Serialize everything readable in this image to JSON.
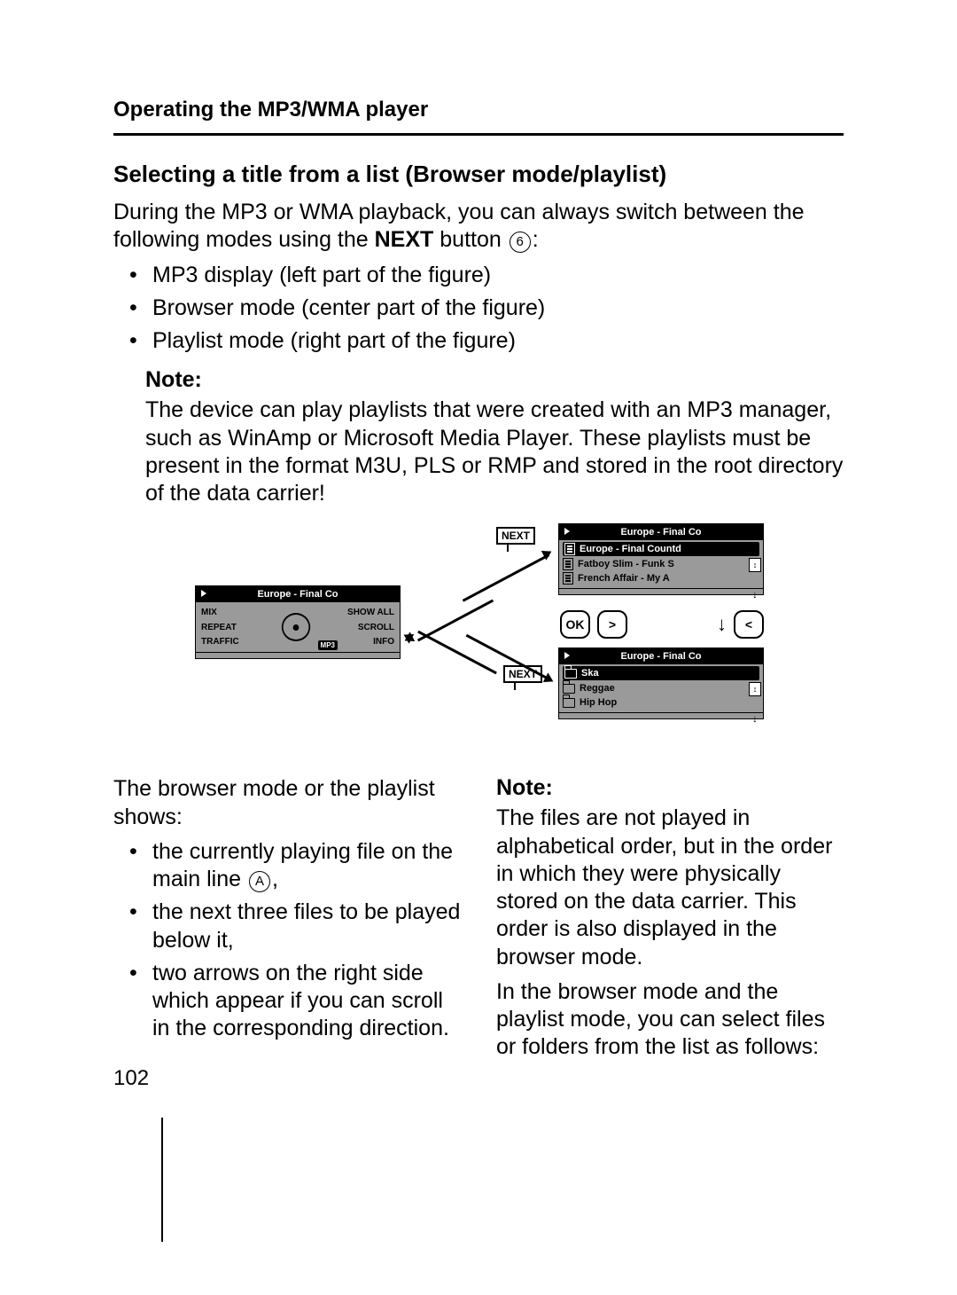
{
  "header": {
    "section": "Operating the MP3/WMA player"
  },
  "h2": "Selecting a title from a list (Browser mode/playlist)",
  "intro": {
    "pre": "During the MP3 or WMA playback, you can always switch between the following modes using the ",
    "bold": "NEXT",
    "post": " button ",
    "ref": "6",
    "end": ":"
  },
  "modes": [
    "MP3 display (left part of the figure)",
    "Browser mode (center part of the figure)",
    "Playlist mode (right part of the figure)"
  ],
  "note1": {
    "h": "Note:",
    "text": "The device can play playlists that were created with an MP3 manager, such as WinAmp or Microsoft Media Player. These playlists must be present in the format M3U, PLS or RMP and stored in the root directory of the data carrier!"
  },
  "figure": {
    "next_label": "NEXT",
    "left": {
      "title": "Europe - Final Co",
      "left_opts": [
        "MIX",
        "REPEAT",
        "TRAFFIC"
      ],
      "right_opts": [
        "SHOW ALL",
        "SCROLL",
        "INFO"
      ],
      "tag": "MP3"
    },
    "playlist": {
      "title": "Europe - Final Co",
      "items": [
        "Europe - Final Countd",
        "Fatboy Slim - Funk S",
        "French Affair - My A"
      ]
    },
    "browser": {
      "title": "Europe - Final Co",
      "items": [
        "Ska",
        "Reggae",
        "Hip Hop"
      ]
    },
    "buttons": {
      "ok": "OK",
      "fwd": ">",
      "back": "<"
    }
  },
  "lower_left": {
    "lead": "The browser mode or the playlist shows:",
    "items": {
      "a_pre": "the currently playing file on the main line ",
      "a_ref": "A",
      "a_post": ",",
      "b": "the next three files to be played below it,",
      "c": "two arrows on the right side which appear if you can scroll in the corresponding direction."
    }
  },
  "lower_right": {
    "note_h": "Note:",
    "note_text": "The files are not played in alphabetical order, but in the order in which they were physically stored on the data carrier. This order is also displayed in the browser mode.",
    "tail": "In the browser mode and the playlist mode, you can select files or folders from the list as follows:"
  },
  "page_number": "102"
}
